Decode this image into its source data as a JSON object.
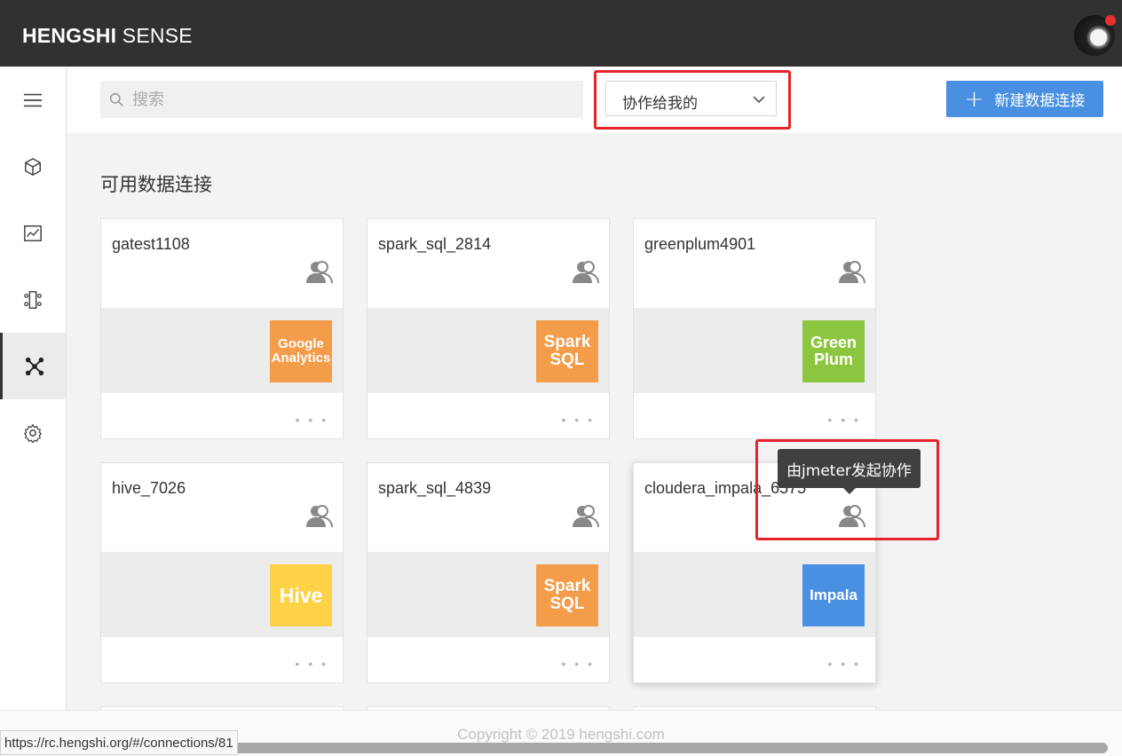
{
  "header": {
    "brand_bold": "HENGSHI",
    "brand_light": "SENSE"
  },
  "toolbar": {
    "search_placeholder": "搜索",
    "filter_selected": "协作给我的",
    "new_button_label": "新建数据连接"
  },
  "section_title": "可用数据连接",
  "cards": [
    {
      "name": "gatest1108",
      "logo_line1": "Google",
      "logo_line2": "Analytics",
      "logo_color": "#f39c4a"
    },
    {
      "name": "spark_sql_2814",
      "logo_line1": "Spark",
      "logo_line2": "SQL",
      "logo_color": "#f39c4a"
    },
    {
      "name": "greenplum4901",
      "logo_line1": "Green",
      "logo_line2": "Plum",
      "logo_color": "#8cc63f"
    },
    {
      "name": "hive_7026",
      "logo_line1": "Hive",
      "logo_line2": "",
      "logo_color": "#fdd247"
    },
    {
      "name": "spark_sql_4839",
      "logo_line1": "Spark",
      "logo_line2": "SQL",
      "logo_color": "#f39c4a"
    },
    {
      "name": "cloudera_impala_6575",
      "logo_line1": "Impala",
      "logo_line2": "",
      "logo_color": "#4a90e2"
    }
  ],
  "more_label": "• • •",
  "tooltip": "由jmeter发起协作",
  "footer": {
    "copyright": "Copyright © 2019 hengshi.com"
  },
  "status_url": "https://rc.hengshi.org/#/connections/81",
  "colors": {
    "topbar": "#313131",
    "accent": "#4a90e2",
    "highlight": "#e5232a"
  },
  "icons": [
    "menu-icon",
    "cube-icon",
    "chart-icon",
    "data-flow-icon",
    "connection-icon",
    "settings-icon",
    "search-icon",
    "chevron-down-icon",
    "users-icon"
  ]
}
